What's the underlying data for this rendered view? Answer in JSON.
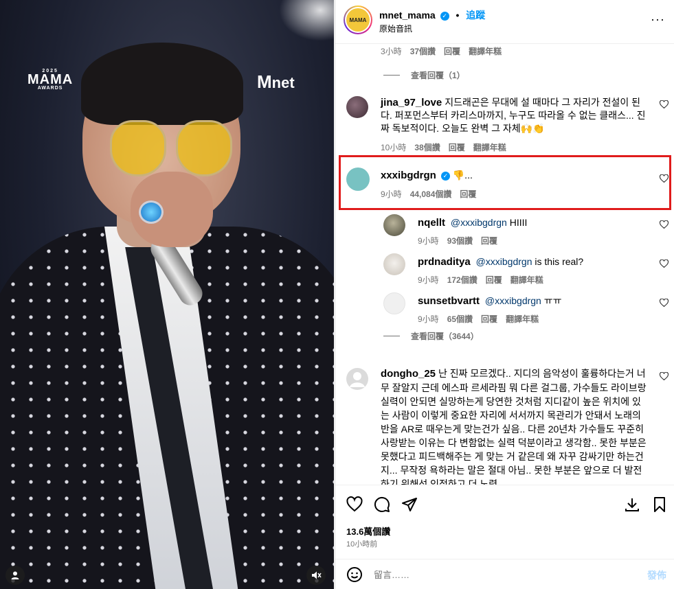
{
  "video": {
    "logo_year": "2025",
    "logo_mama": "MAMA",
    "logo_awards": "AWARDS",
    "logo_mnet_m": "M",
    "logo_mnet_text": "net",
    "user_icon": "user-icon",
    "mute_icon": "speaker-muted-icon"
  },
  "header": {
    "avatar_text": "MAMA",
    "username": "mnet_mama",
    "verified_glyph": "✓",
    "dot": "•",
    "follow": "追蹤",
    "audio": "原始音訊",
    "more": "···"
  },
  "comments": {
    "top_meta": {
      "time": "3小時",
      "likes": "37個讚",
      "reply": "回覆",
      "translate": "翻譯年糕"
    },
    "view_replies_1": "查看回覆（1）",
    "c1": {
      "user": "jina_97_love",
      "text": "지드래곤은 무대에 설 때마다 그 자리가 전설이 된다. 퍼포먼스부터 카리스마까지, 누구도 따라올 수 없는 클래스... 진짜 독보적이다. 오늘도 완벽 그 자체🙌👏",
      "time": "10小時",
      "likes": "38個讚",
      "reply": "回覆",
      "translate": "翻譯年糕"
    },
    "c2": {
      "user": "xxxibgdrgn",
      "text": "👎...",
      "time": "9小時",
      "likes": "44,084個讚",
      "reply": "回覆"
    },
    "r1": {
      "user": "nqellt",
      "mention": "@xxxibgdrgn",
      "text": "HIIII",
      "time": "9小時",
      "likes": "93個讚",
      "reply": "回覆"
    },
    "r2": {
      "user": "prdnaditya",
      "mention": "@xxxibgdrgn",
      "text": "is this real?",
      "time": "9小時",
      "likes": "172個讚",
      "reply": "回覆",
      "translate": "翻譯年糕"
    },
    "r3": {
      "user": "sunsetbvartt",
      "mention": "@xxxibgdrgn",
      "text": "ㅠㅠ",
      "time": "9小時",
      "likes": "65個讚",
      "reply": "回覆",
      "translate": "翻譯年糕"
    },
    "view_replies_2": "查看回覆（3644）",
    "c3": {
      "user": "dongho_25",
      "text": "난 진짜 모르겠다.. 지디의 음악성이 훌륭하다는거 너무 잘알지 근데 에스파 르세라핌 뭐 다른 걸그룹, 가수들도 라이브랑 실력이 안되면 실망하는게 당연한 것처럼 지디같이 높은 위치에 있는 사람이 이렇게 중요한 자리에 서서까지 목관리가 안돼서 노래의 반을 AR로 때우는게 맞는건가 싶음.. 다른 20년차 가수들도 꾸준히 사랑받는 이유는 다 변함없는 실력 덕분이라고 생각함.. 못한 부분은 못했다고 피드백해주는 게 맞는 거 같은데 왜 자꾸 감싸기만 하는건지... 무작정 욕하라는 말은 절대 아님.. 못한 부분은 앞으로 더 발전하기 위해선 인정하고 더 노력"
    }
  },
  "actions": {
    "like_icon": "heart-icon",
    "comment_icon": "comment-icon",
    "share_icon": "send-icon",
    "download_icon": "download-icon",
    "save_icon": "bookmark-icon",
    "likes": "13.6萬個讚",
    "when": "10小時前"
  },
  "composer": {
    "emoji_icon": "smile-icon",
    "placeholder": "留言……",
    "post": "發佈"
  },
  "colors": {
    "accent": "#0095f6",
    "highlight": "#e01b1b",
    "muted": "#737373"
  }
}
